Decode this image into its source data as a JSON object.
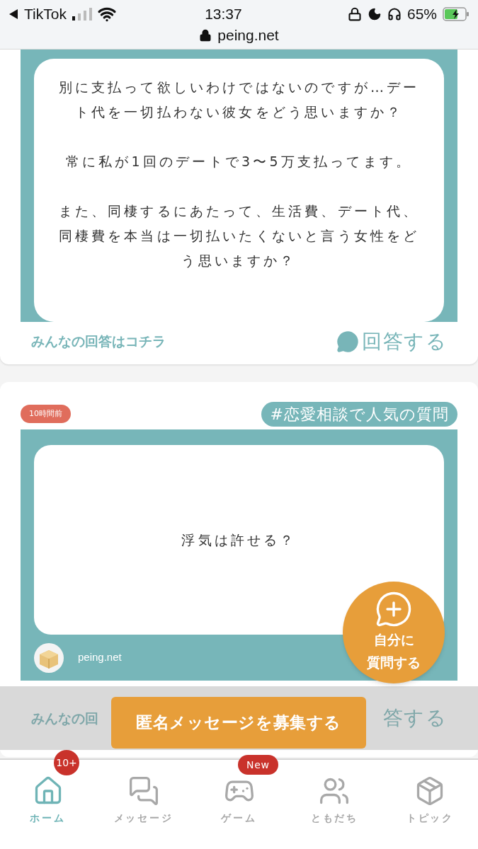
{
  "status_bar": {
    "back_app": "TikTok",
    "time": "13:37",
    "battery": "65%",
    "url": "peing.net"
  },
  "cards": [
    {
      "question_paragraphs": [
        "別に支払って欲しいわけではないのですが…デート代を一切払わない彼女をどう思いますか？",
        "常に私が1回のデートで3〜5万支払ってます。",
        "また、同棲するにあたって、生活費、デート代、同棲費を本当は一切払いたくないと言う女性をどう思いますか？"
      ],
      "footer": {
        "all_answers_link": "みんなの回答はコチラ",
        "answer_button": "回答する"
      }
    },
    {
      "time_badge": "10時間前",
      "tag": "#恋愛相談で人気の質問",
      "question_paragraphs": [
        "浮気は許せる？"
      ],
      "site": "peing.net"
    }
  ],
  "hidden_footer": {
    "left": "みんなの回",
    "right": "答する"
  },
  "fab": {
    "label_lines": [
      "自分に",
      "質問する"
    ]
  },
  "banner": "匿名メッセージを募集する",
  "tabs": [
    {
      "label": "ホーム",
      "kind": "home",
      "selected": true,
      "badge": "10+"
    },
    {
      "label": "メッセージ",
      "kind": "messages",
      "selected": false
    },
    {
      "label": "ゲーム",
      "kind": "game",
      "selected": false,
      "badge": "New"
    },
    {
      "label": "ともだち",
      "kind": "friends",
      "selected": false
    },
    {
      "label": "トピック",
      "kind": "topic",
      "selected": false
    }
  ]
}
